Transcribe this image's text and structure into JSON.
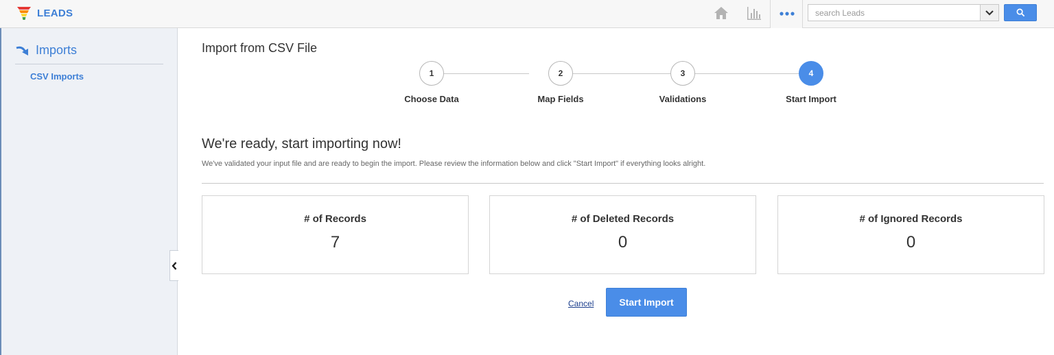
{
  "app": {
    "name": "LEADS"
  },
  "topbar": {
    "home_icon": "home-icon",
    "reports_icon": "bar-chart-icon",
    "more_icon": "more-dots-icon",
    "search": {
      "placeholder": "search Leads",
      "value": ""
    }
  },
  "sidebar": {
    "section": {
      "label": "Imports",
      "icon": "arrow-curve-icon"
    },
    "items": [
      {
        "label": "CSV Imports",
        "active": true
      }
    ]
  },
  "main": {
    "title": "Import from CSV File",
    "steps": [
      {
        "number": "1",
        "label": "Choose Data",
        "active": false
      },
      {
        "number": "2",
        "label": "Map Fields",
        "active": false
      },
      {
        "number": "3",
        "label": "Validations",
        "active": false
      },
      {
        "number": "4",
        "label": "Start Import",
        "active": true
      }
    ],
    "ready_title": "We're ready, start importing now!",
    "ready_description": "We've validated your input file and are ready to begin the import. Please review the information below and click \"Start Import\" if everything looks alright.",
    "stats": [
      {
        "label": "# of Records",
        "value": "7"
      },
      {
        "label": "# of Deleted Records",
        "value": "0"
      },
      {
        "label": "# of Ignored Records",
        "value": "0"
      }
    ],
    "cancel_label": "Cancel",
    "start_label": "Start Import"
  },
  "colors": {
    "accent": "#4a8de8",
    "link": "#3d7fd6",
    "sidebar_bg": "#eef1f6"
  }
}
